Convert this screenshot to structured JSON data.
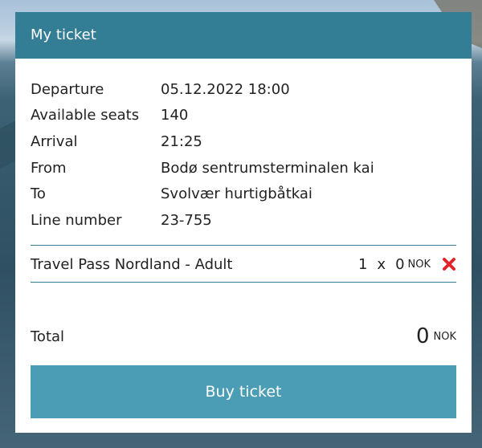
{
  "header": {
    "title": "My ticket"
  },
  "details": [
    {
      "label": "Departure",
      "value": "05.12.2022 18:00"
    },
    {
      "label": "Available seats",
      "value": "140"
    },
    {
      "label": "Arrival",
      "value": "21:25"
    },
    {
      "label": "From",
      "value": "Bodø sentrumsterminalen kai"
    },
    {
      "label": "To",
      "value": "Svolvær hurtigbåtkai"
    },
    {
      "label": "Line number",
      "value": "23-755"
    }
  ],
  "line_item": {
    "name": "Travel Pass Nordland - Adult",
    "quantity": "1",
    "multiplier": "x",
    "price": "0",
    "currency": "NOK",
    "remove_icon": "close-icon",
    "remove_color": "#e0262b"
  },
  "total": {
    "label": "Total",
    "value": "0",
    "currency": "NOK"
  },
  "buy_button": {
    "label": "Buy ticket",
    "color": "#4b9db5"
  },
  "colors": {
    "header": "#337d95",
    "divider": "#337d95"
  }
}
